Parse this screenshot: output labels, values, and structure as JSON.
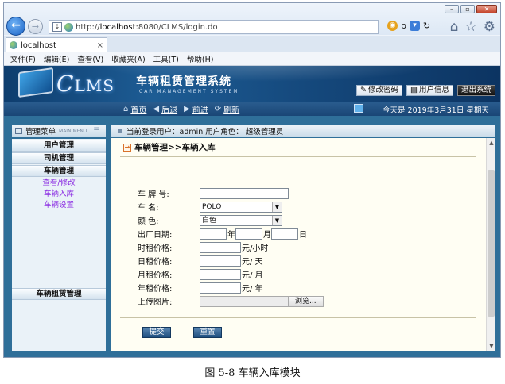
{
  "browser": {
    "url_prefix": "http://",
    "url_host": "localhost",
    "url_rest": ":8080/CLMS/login.do",
    "tab_title": "localhost",
    "tab_close": "×",
    "address_search": "ρ",
    "menu": [
      "文件(F)",
      "编辑(E)",
      "查看(V)",
      "收藏夹(A)",
      "工具(T)",
      "帮助(H)"
    ]
  },
  "header": {
    "logo_c": "C",
    "logo_rest": "LMS",
    "system_title": "车辆租赁管理系统",
    "system_subtitle": "CAR MANAGEMENT SYSTEM",
    "buttons": {
      "change_password": "修改密码",
      "user_info": "用户信息",
      "logout": "退出系统"
    }
  },
  "navbar": {
    "home": "首页",
    "back": "后退",
    "forward": "前进",
    "refresh": "刷新",
    "date": "今天是  2019年3月31日  星期天"
  },
  "sidebar": {
    "title": "管理菜单",
    "title_en": "MAIN MENU",
    "categories": {
      "user": "用户管理",
      "driver": "司机管理",
      "vehicle": "车辆管理",
      "rental": "车辆租赁管理"
    },
    "vehicle_links": [
      "查看/修改",
      "车辆入库",
      "车辆设置"
    ]
  },
  "content": {
    "login_info": "当前登录用户：admin  用户角色：  超级管理员",
    "breadcrumb": "车辆管理>>车辆入库",
    "form": {
      "plate_label": "车  牌  号:",
      "name_label": "车      名:",
      "name_value": "POLO",
      "color_label": "颜      色:",
      "color_value": "白色",
      "date_label": "出厂日期:",
      "year_unit": "年",
      "month_unit": "月",
      "day_unit": "日",
      "hour_price_label": "时租价格:",
      "hour_unit": "元/小时",
      "day_price_label": "日租价格:",
      "day_price_unit": "元/  天",
      "month_price_label": "月租价格:",
      "month_price_unit": "元/  月",
      "year_price_label": "年租价格:",
      "year_price_unit": "元/  年",
      "image_label": "上传图片:",
      "browse": "浏览..."
    },
    "submit": "提交",
    "reset": "重置"
  },
  "caption": "图 5-8  车辆入库模块"
}
